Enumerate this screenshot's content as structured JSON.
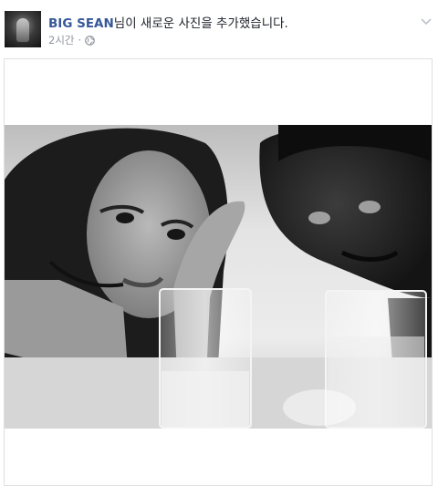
{
  "post": {
    "author": "BIG SEAN",
    "action_text": "님이 새로운 사진을 추가했습니다.",
    "timestamp": "2시간",
    "separator": "·",
    "privacy_icon": "globe-icon",
    "menu_icon": "chevron-down-icon",
    "photo_alt": "사진"
  }
}
